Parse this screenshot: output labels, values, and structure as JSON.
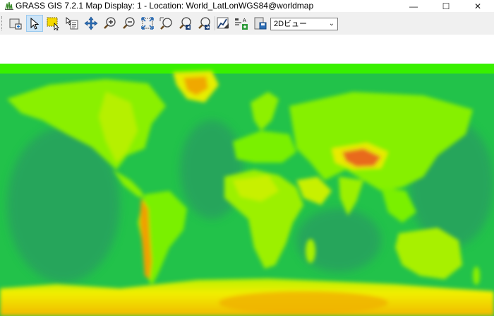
{
  "window": {
    "title": "GRASS GIS 7.2.1 Map Display: 1  - Location: World_LatLonWGS84@worldmap",
    "minimize_glyph": "—",
    "maximize_glyph": "☐",
    "close_glyph": "✕"
  },
  "toolbar": {
    "tools": [
      {
        "name": "render-map-icon",
        "active": false
      },
      {
        "name": "pointer-icon",
        "active": true
      },
      {
        "name": "select-vector-icon",
        "active": false
      },
      {
        "name": "query-icon",
        "active": false
      },
      {
        "name": "pan-icon",
        "active": false
      },
      {
        "name": "zoom-in-icon",
        "active": false
      },
      {
        "name": "zoom-out-icon",
        "active": false
      },
      {
        "name": "zoom-extent-icon",
        "active": false
      },
      {
        "name": "zoom-region-icon",
        "active": false
      },
      {
        "name": "zoom-back-icon",
        "active": false
      },
      {
        "name": "zoom-options-icon",
        "active": false
      },
      {
        "name": "analyze-icon",
        "active": false
      },
      {
        "name": "add-overlay-icon",
        "active": false
      },
      {
        "name": "save-icon",
        "active": false
      }
    ],
    "view_mode": {
      "value": "2Dビュー"
    }
  },
  "map": {
    "colors": {
      "low": "#00ee00",
      "mid": "#7ff000",
      "high": "#e8f000",
      "peak": "#f08a00",
      "ocean_deep": "#23a85a"
    }
  }
}
